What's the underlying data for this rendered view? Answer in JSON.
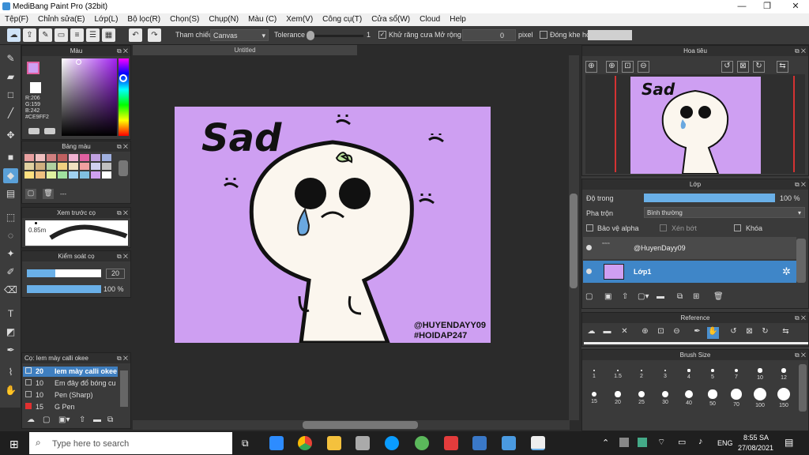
{
  "app": {
    "title": "MediBang Paint Pro (32bit)",
    "minimize": "—",
    "maximize": "❐",
    "close": "✕"
  },
  "menu": [
    "Tệp(F)",
    "Chỉnh sửa(E)",
    "Lớp(L)",
    "Bộ lọc(R)",
    "Chọn(S)",
    "Chụp(N)",
    "Màu (C)",
    "Xem(V)",
    "Công cụ(T)",
    "Cửa sổ(W)",
    "Cloud",
    "Help"
  ],
  "toolbar": {
    "ref_label": "Tham chiếu",
    "ref_value": "Canvas",
    "tolerance_label": "Tolerance",
    "tolerance_value": "1",
    "antialias_label": "Khử răng cưa",
    "expand_label": "Mở rộng",
    "expand_value": "0",
    "expand_unit": "pixel",
    "close_gap_label": "Đóng khe hở"
  },
  "document": {
    "tab": "Untitled"
  },
  "color_panel": {
    "title": "Màu",
    "r": "R:206",
    "g": "G:159",
    "b": "B:242",
    "hex": "#CE9FF2",
    "accent": "#ce9ff2"
  },
  "palette_panel": {
    "title": "Bảng màu",
    "extra": "---"
  },
  "preview_panel": {
    "title": "Xem trước cọ",
    "size": "0.85m"
  },
  "brush_control": {
    "title": "Kiểm soát cọ",
    "size": "20",
    "opacity": "100 %"
  },
  "brush_list": {
    "title": "Cọ: Iem mày calli okee",
    "items": [
      {
        "size": "20",
        "name": "Iem mày calli okee"
      },
      {
        "size": "10",
        "name": "Em đây đổ bóng cu"
      },
      {
        "size": "10",
        "name": "Pen (Sharp)"
      },
      {
        "size": "15",
        "name": "G Pen"
      }
    ]
  },
  "artwork": {
    "sad": "Sad",
    "credit1": "@HUYENDAYY09",
    "credit2": "#HOIDAP247",
    "bg": "#ce9ff2"
  },
  "navigator": {
    "title": "Hoa tiêu"
  },
  "layer_panel": {
    "title": "Lớp",
    "opacity_label": "Độ trong",
    "opacity_value": "100 %",
    "blend_label": "Pha trộn",
    "blend_value": "Bình thường",
    "protect_alpha": "Bảo vệ alpha",
    "clipping": "Xén bớt",
    "lock": "Khóa",
    "layers": [
      {
        "name": "@HuyenDayy09"
      },
      {
        "name": "Lớp1"
      }
    ]
  },
  "reference_panel": {
    "title": "Reference"
  },
  "brush_size_panel": {
    "title": "Brush Size",
    "sizes": [
      "1",
      "1.5",
      "2",
      "3",
      "4",
      "5",
      "7",
      "10",
      "12",
      "15",
      "20",
      "25",
      "30",
      "40",
      "50",
      "70",
      "100",
      "150"
    ]
  },
  "taskbar": {
    "search_placeholder": "Type here to search",
    "lang": "ENG",
    "time": "8:55 SA",
    "date": "27/08/2021"
  }
}
